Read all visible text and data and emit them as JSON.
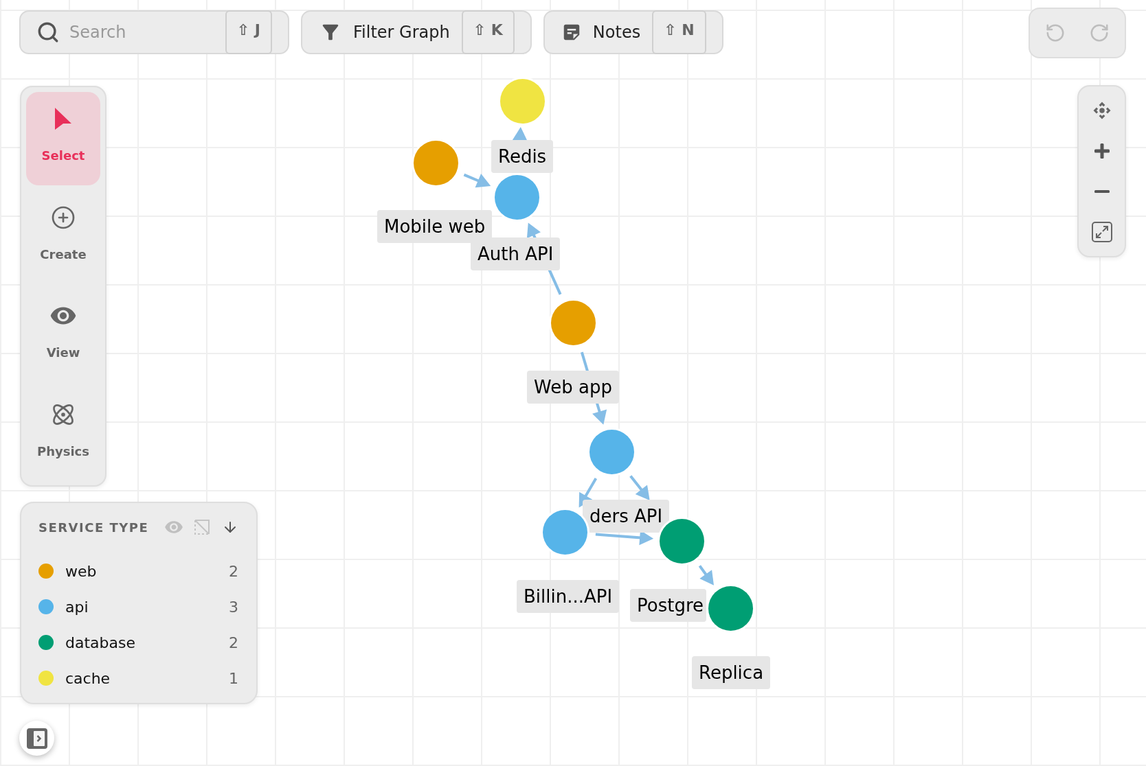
{
  "toolbar": {
    "search": {
      "placeholder": "Search",
      "shortcut": "⇧ J"
    },
    "buttons": [
      {
        "kind": "filter",
        "label": "Filter Graph",
        "shortcut": "⇧ K"
      },
      {
        "kind": "notes",
        "label": "Notes",
        "shortcut": "⇧ N"
      }
    ]
  },
  "history": [
    {
      "kind": "undo",
      "disabled": true
    },
    {
      "kind": "redo",
      "disabled": true
    }
  ],
  "tools": [
    {
      "kind": "select",
      "label": "Select",
      "selected": true
    },
    {
      "kind": "create",
      "label": "Create",
      "selected": false
    },
    {
      "kind": "view",
      "label": "View",
      "selected": false
    },
    {
      "kind": "physics",
      "label": "Physics",
      "selected": false
    }
  ],
  "legend": {
    "title": "SERVICE TYPE",
    "items": [
      {
        "label": "web",
        "count": "2",
        "color": "#e69f00"
      },
      {
        "label": "api",
        "count": "3",
        "color": "#56b4e9"
      },
      {
        "label": "database",
        "count": "2",
        "color": "#009e73"
      },
      {
        "label": "cache",
        "count": "1",
        "color": "#f0e442"
      }
    ]
  },
  "graph": {
    "nodes": [
      {
        "label": "Redis",
        "color": "#f0e442"
      },
      {
        "label": "Mobile web",
        "color": "#e69f00"
      },
      {
        "label": "Auth API",
        "color": "#56b4e9"
      },
      {
        "label": "Web app",
        "color": "#e69f00"
      },
      {
        "label": "ders API",
        "color": "#56b4e9"
      },
      {
        "label": "Billin...API",
        "color": "#56b4e9"
      },
      {
        "label": "Postgre",
        "color": "#009e73"
      },
      {
        "label": "Replica",
        "color": "#009e73"
      }
    ]
  }
}
